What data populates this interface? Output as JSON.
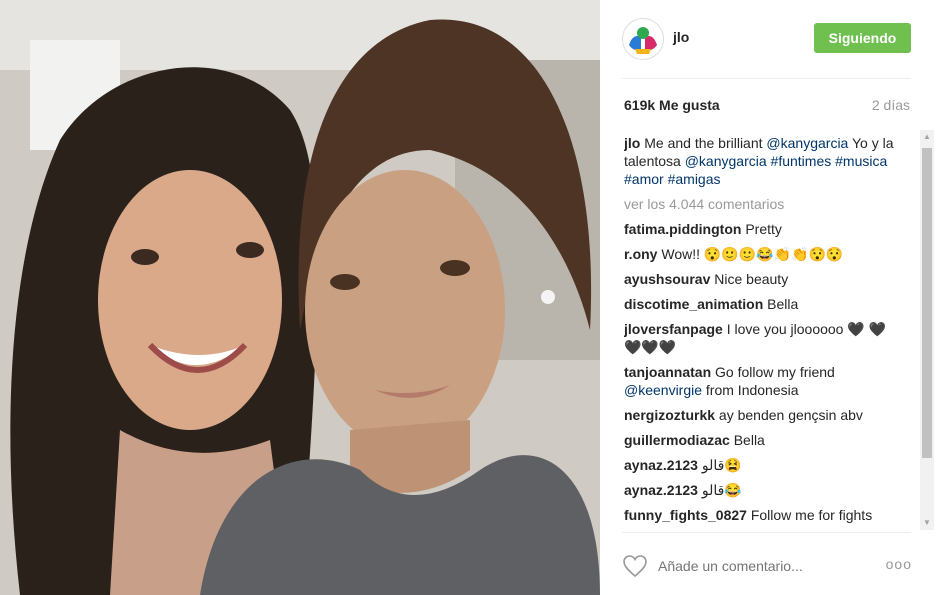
{
  "post": {
    "username": "jlo",
    "follow_label": "Siguiendo",
    "likes": "619k Me gusta",
    "time": "2 días",
    "caption": {
      "username": "jlo",
      "text_1": "Me and the brilliant",
      "mention_1": "@kanygarcia",
      "text_2": "Yo y la talentosa",
      "mention_2": "@kanygarcia",
      "tags": [
        "#funtimes",
        "#musica",
        "#amor",
        "#amigas"
      ]
    },
    "view_all": "ver los 4.044 comentarios",
    "comments": [
      {
        "user": "fatima.piddington",
        "text": "Pretty"
      },
      {
        "user": "r.ony",
        "text": "Wow!! 😯🙂🙂😂👏👏😯😯"
      },
      {
        "user": "ayushsourav",
        "text": "Nice beauty"
      },
      {
        "user": "discotime_animation",
        "text": "Bella"
      },
      {
        "user": "jloversfanpage",
        "text": "I love you jloooooo 🖤 🖤 🖤🖤🖤"
      },
      {
        "user": "tanjoannatan",
        "text": "Go follow my friend",
        "mention": "@keenvirgie",
        "text_after": "from Indonesia"
      },
      {
        "user": "nergizozturkk",
        "text": "ay benden gençsin abv"
      },
      {
        "user": "guillermodiazac",
        "text": "Bella"
      },
      {
        "user": "aynaz.2123",
        "text": "قالو😫"
      },
      {
        "user": "aynaz.2123",
        "text": "قالو😂"
      },
      {
        "user": "funny_fights_0827",
        "text": "Follow me for fights"
      }
    ],
    "comment_placeholder": "Añade un comentario...",
    "more_label": "ooo"
  },
  "colors": {
    "follow": "#70c050",
    "link": "#003569",
    "muted": "#999999"
  },
  "icons": [
    "heart-icon",
    "more-options-icon",
    "avatar-logo"
  ]
}
